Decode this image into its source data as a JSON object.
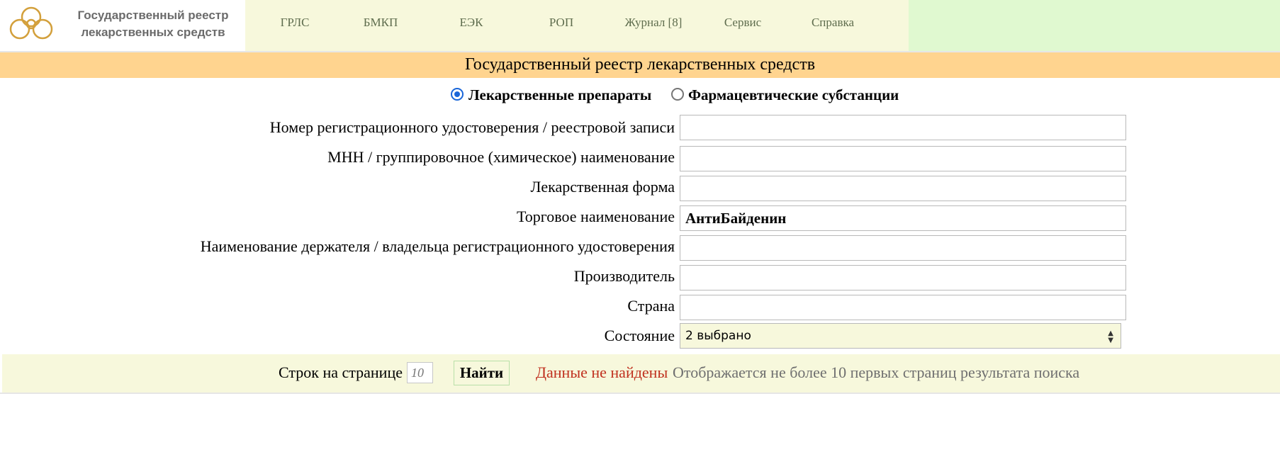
{
  "header": {
    "brand_line1": "Государственный реестр",
    "brand_line2": "лекарственных средств",
    "nav": [
      {
        "label": "ГРЛС"
      },
      {
        "label": "БМКП"
      },
      {
        "label": "ЕЭК"
      },
      {
        "label": "РОП"
      },
      {
        "label": "Журнал [8]"
      },
      {
        "label": "Сервис"
      },
      {
        "label": "Справка"
      }
    ]
  },
  "page_title": "Государственный реестр лекарственных средств",
  "search_type": {
    "options": [
      {
        "label": "Лекарственные препараты",
        "selected": true
      },
      {
        "label": "Фармацевтические субстанции",
        "selected": false
      }
    ]
  },
  "form": {
    "fields": [
      {
        "label": "Номер регистрационного удостоверения / реестровой записи",
        "value": ""
      },
      {
        "label": "МНН / группировочное (химическое) наименование",
        "value": ""
      },
      {
        "label": "Лекарственная форма",
        "value": ""
      },
      {
        "label": "Торговое наименование",
        "value": "АнтиБайденин"
      },
      {
        "label": "Наименование держателя / владельца регистрационного удостоверения",
        "value": ""
      },
      {
        "label": "Производитель",
        "value": ""
      },
      {
        "label": "Страна",
        "value": ""
      }
    ],
    "state": {
      "label": "Состояние",
      "value": "2 выбрано"
    }
  },
  "footer": {
    "rows_label": "Строк на странице",
    "rows_placeholder": "10",
    "find_button": "Найти",
    "status_error": "Данные не найдены",
    "status_note": "Отображается не более 10 первых страниц результата поиска"
  },
  "colors": {
    "nav_bg": "#f7f8dc",
    "title_band": "#ffd48f",
    "accent_green": "#e0f9d0",
    "error_text": "#c0311f",
    "radio_blue": "#1a66d9"
  }
}
